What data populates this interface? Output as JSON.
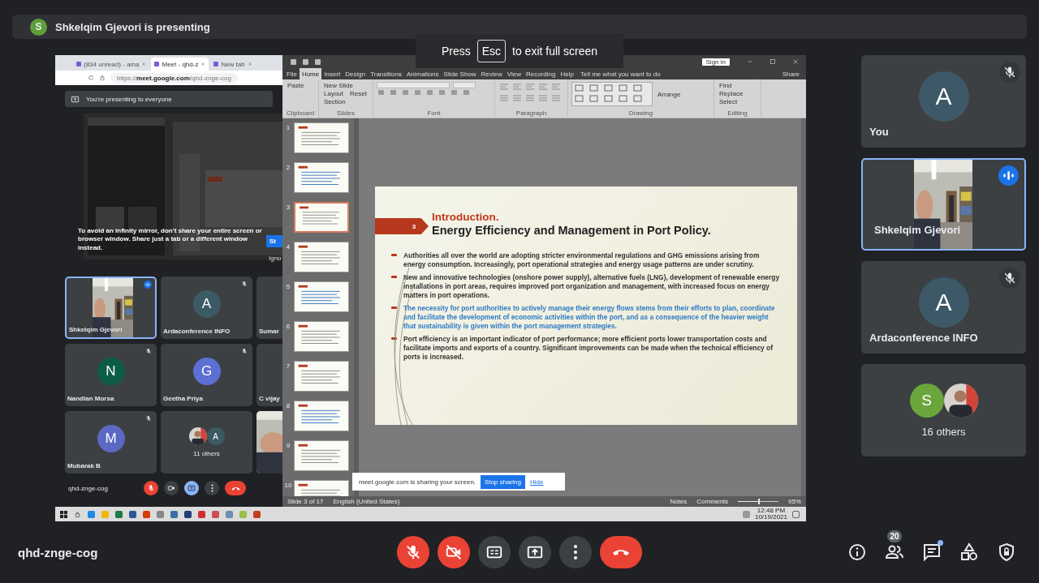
{
  "presenter_bar": {
    "initial": "S",
    "text": "Shkelqim Gjevori is presenting"
  },
  "fullscreen_hint": {
    "before": "Press",
    "key": "Esc",
    "after": "to exit full screen"
  },
  "shared_screen": {
    "browser": {
      "tabs": [
        {
          "label": "(834 unread) - ama",
          "selected": false
        },
        {
          "label": "Meet - qhd-z",
          "selected": true
        },
        {
          "label": "New tab",
          "selected": false
        }
      ],
      "url": "https://**meet.google.com**/qhd-znge-cog",
      "banner": "You're presenting to everyone",
      "warning": "To avoid an infinity mirror, don't share your entire screen or browser window. Share just a tab or a different window instead.",
      "warning_button": "St",
      "warning_link": "Igno",
      "tiles": [
        {
          "kind": "video",
          "name": "Shkelqim Gjevori",
          "speaking": true
        },
        {
          "kind": "avatar",
          "initial": "A",
          "color": "#3c5a63",
          "name": "Ardaconference INFO",
          "speaking": false,
          "muted": true
        },
        {
          "kind": "avatar",
          "name": "Sumar",
          "speaking": false
        },
        {
          "kind": "avatar",
          "initial": "N",
          "color": "#0d5c47",
          "name": "Nandlan Morsa",
          "speaking": false,
          "muted": true
        },
        {
          "kind": "avatar",
          "initial": "G",
          "color": "#5c6fd3",
          "name": "Geetha Priya",
          "speaking": false,
          "muted": true
        },
        {
          "kind": "avatar",
          "name": "C vijay",
          "speaking": false
        },
        {
          "kind": "avatar",
          "initial": "M",
          "color": "#5b68c4",
          "name": "Mubarak B",
          "speaking": false,
          "muted": true
        },
        {
          "kind": "others",
          "initial": "A",
          "color": "#3c5a63",
          "label": "11 others",
          "photo_first": true
        },
        {
          "kind": "video",
          "speaking": false
        }
      ],
      "meeting_code": "qhd-znge-cog",
      "controls": [
        {
          "kind": "mic",
          "off": true
        },
        {
          "kind": "camera",
          "off": false
        },
        {
          "kind": "present"
        },
        {
          "kind": "more"
        },
        {
          "kind": "hangup"
        }
      ]
    },
    "powerpoint": {
      "sign_in": "Sign in",
      "menu": [
        {
          "label": "File",
          "selected": false
        },
        {
          "label": "Home",
          "selected": true
        },
        {
          "label": "Insert",
          "selected": false
        },
        {
          "label": "Design",
          "selected": false
        },
        {
          "label": "Transitions",
          "selected": false
        },
        {
          "label": "Animations",
          "selected": false
        },
        {
          "label": "Slide Show",
          "selected": false
        },
        {
          "label": "Review",
          "selected": false
        },
        {
          "label": "View",
          "selected": false
        },
        {
          "label": "Recording",
          "selected": false
        },
        {
          "label": "Help",
          "selected": false
        }
      ],
      "tell_me": "Tell me what you want to do",
      "share": "Share",
      "ribbon_groups": [
        {
          "kind": "clipboard",
          "label": "Clipboard",
          "buttons": [
            "Paste"
          ]
        },
        {
          "kind": "slides",
          "label": "Slides",
          "buttons": [
            "New Slide",
            "Layout",
            "Reset",
            "Section"
          ]
        },
        {
          "kind": "font",
          "label": "Font"
        },
        {
          "kind": "paragraph",
          "label": "Paragraph"
        },
        {
          "kind": "drawing",
          "label": "Drawing",
          "buttons": [
            "Arrange"
          ]
        },
        {
          "kind": "editing",
          "label": "Editing",
          "buttons": [
            "Find",
            "Replace",
            "Select"
          ]
        }
      ],
      "thumbnails": [
        {
          "number": "1",
          "selected": false
        },
        {
          "number": "2",
          "selected": false
        },
        {
          "number": "3",
          "selected": true
        },
        {
          "number": "4",
          "selected": false
        },
        {
          "number": "5",
          "selected": false
        },
        {
          "number": "6",
          "selected": false
        },
        {
          "number": "7",
          "selected": false
        },
        {
          "number": "8",
          "selected": false
        },
        {
          "number": "9",
          "selected": false
        },
        {
          "number": "10",
          "selected": false
        }
      ],
      "slide": {
        "number": "3",
        "heading": "Introduction.",
        "title": "Energy Efficiency and Management in Port Policy.",
        "bullets": [
          {
            "text": "Authorities all over the world are adopting stricter environmental regulations and GHG emissions arising from energy consumption. Increasingly, port operational strategies and energy usage patterns are under scrutiny.",
            "highlighted": false
          },
          {
            "text": "New and innovative technologies (onshore power supply), alternative fuels (LNG), development of renewable energy installations in port areas, requires improved port organization and management, with increased focus on energy matters in port operations.",
            "highlighted": false
          },
          {
            "text": "The necessity for port authorities to actively manage their energy flows stems from their efforts to plan, coordinate and facilitate the development of economic activities within the port, and as a consequence of the heavier weight that sustainability is given within the port management strategies.",
            "highlighted": true
          },
          {
            "text": "Port efficiency is an important indicator of port performance; more efficient ports lower transportation costs and facilitate imports and exports of a country. Significant improvements can be made when the technical efficiency of ports is increased.",
            "highlighted": false
          }
        ]
      },
      "share_notice": {
        "text": "meet.google.com is sharing your screen.",
        "stop": "Stop sharing",
        "hide": "Hide"
      },
      "status_bar": {
        "slide": "Slide 3 of 17",
        "language": "English (United States)",
        "notes": "Notes",
        "comments": "Comments",
        "zoom_slider": {
          "level": 0.5
        },
        "zoom": "95%"
      }
    },
    "taskbar": {
      "time": "12:48 PM",
      "date": "10/19/2021"
    }
  },
  "side_tiles": [
    {
      "kind": "avatar",
      "initial": "A",
      "color": "#3d5866",
      "name": "You",
      "speaking": false,
      "muted": true
    },
    {
      "kind": "video",
      "name": "Shkelqim Gjevori",
      "speaking": true
    },
    {
      "kind": "avatar",
      "initial": "A",
      "color": "#3d5866",
      "name": "Ardaconference INFO",
      "speaking": false,
      "muted": true
    },
    {
      "kind": "others",
      "initial": "S",
      "color": "#6aa63b",
      "label": "16 others",
      "photo_first": false
    }
  ],
  "meeting_code": "qhd-znge-cog",
  "controls": [
    {
      "kind": "mic",
      "off": true
    },
    {
      "kind": "camera",
      "off": true
    },
    {
      "kind": "captions"
    },
    {
      "kind": "present"
    },
    {
      "kind": "more"
    },
    {
      "kind": "hangup"
    }
  ],
  "tools": [
    {
      "kind": "info"
    },
    {
      "kind": "people",
      "badge": "20"
    },
    {
      "kind": "chat",
      "unread": true
    },
    {
      "kind": "activities"
    },
    {
      "kind": "safety"
    }
  ]
}
